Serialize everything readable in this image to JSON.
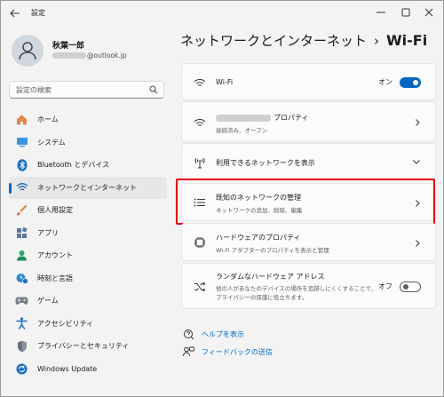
{
  "window": {
    "title": "設定"
  },
  "profile": {
    "name": "秋葉一郎",
    "email_domain": "@outlook.jp"
  },
  "search": {
    "placeholder": "設定の検索"
  },
  "sidebar": {
    "items": [
      {
        "label": "ホーム",
        "icon": "home-icon",
        "color": "#d96b3b"
      },
      {
        "label": "システム",
        "icon": "system-icon",
        "color": "#2b88d8"
      },
      {
        "label": "Bluetooth とデバイス",
        "icon": "bluetooth-icon",
        "color": "#1c6fc4"
      },
      {
        "label": "ネットワークとインターネット",
        "icon": "network-icon",
        "color": "#2b6cb0",
        "active": true
      },
      {
        "label": "個人用設定",
        "icon": "brush-icon",
        "color": "#e08a3a"
      },
      {
        "label": "アプリ",
        "icon": "apps-icon",
        "color": "#4a6785"
      },
      {
        "label": "アカウント",
        "icon": "account-icon",
        "color": "#2aa66a"
      },
      {
        "label": "時刻と言語",
        "icon": "time-language-icon",
        "color": "#2b88d8"
      },
      {
        "label": "ゲーム",
        "icon": "game-icon",
        "color": "#6b7280"
      },
      {
        "label": "アクセシビリティ",
        "icon": "accessibility-icon",
        "color": "#1c6fc4"
      },
      {
        "label": "プライバシーとセキュリティ",
        "icon": "shield-icon",
        "color": "#6b7280"
      },
      {
        "label": "Windows Update",
        "icon": "update-icon",
        "color": "#1c6fc4"
      }
    ]
  },
  "main": {
    "breadcrumb_parent": "ネットワークとインターネット",
    "breadcrumb_sep": "›",
    "breadcrumb_current": "Wi-Fi",
    "cards": [
      {
        "title": "Wi-Fi",
        "toggle_label": "オン",
        "toggle": true
      },
      {
        "title_suffix": "プロパティ",
        "subtitle": "接続済み、オープン"
      },
      {
        "title": "利用できるネットワークを表示"
      },
      {
        "title": "既知のネットワークの管理",
        "subtitle": "ネットワークの追加、削除、編集"
      },
      {
        "title": "ハードウェアのプロパティ",
        "subtitle": "Wi-Fi アダプターのプロパティを表示と管理"
      },
      {
        "title": "ランダムなハードウェア アドレス",
        "subtitle_1": "他の人があなたのデバイスの場所を追跡しにくくすることで、",
        "subtitle_2": "プライバシーの保護に役立ちます。",
        "toggle_label": "オフ",
        "toggle": false
      }
    ],
    "links": [
      {
        "label": "ヘルプを表示",
        "icon": "help-icon"
      },
      {
        "label": "フィードバックの送信",
        "icon": "feedback-icon"
      }
    ]
  },
  "colors": {
    "accent": "#0067c0",
    "highlight": "#e60012"
  }
}
